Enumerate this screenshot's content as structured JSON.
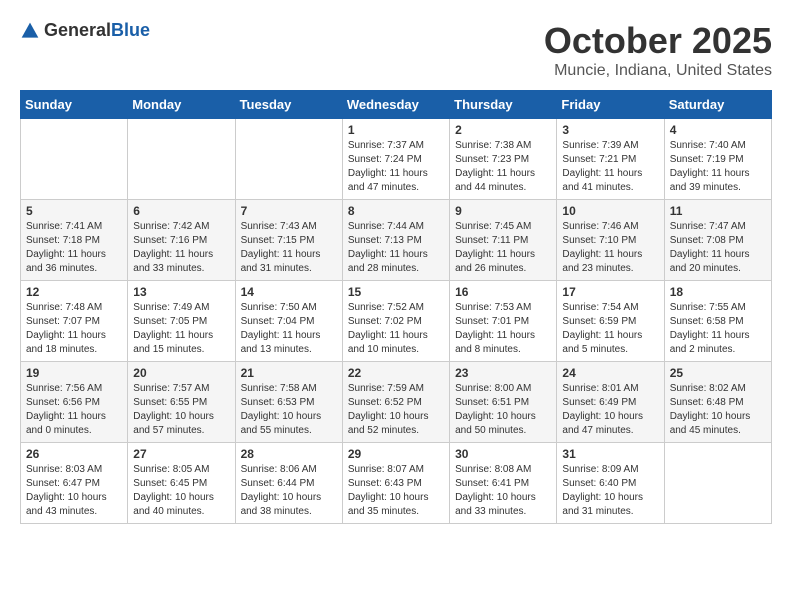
{
  "logo": {
    "general": "General",
    "blue": "Blue"
  },
  "header": {
    "month": "October 2025",
    "location": "Muncie, Indiana, United States"
  },
  "days_of_week": [
    "Sunday",
    "Monday",
    "Tuesday",
    "Wednesday",
    "Thursday",
    "Friday",
    "Saturday"
  ],
  "weeks": [
    [
      {
        "day": "",
        "info": ""
      },
      {
        "day": "",
        "info": ""
      },
      {
        "day": "",
        "info": ""
      },
      {
        "day": "1",
        "info": "Sunrise: 7:37 AM\nSunset: 7:24 PM\nDaylight: 11 hours\nand 47 minutes."
      },
      {
        "day": "2",
        "info": "Sunrise: 7:38 AM\nSunset: 7:23 PM\nDaylight: 11 hours\nand 44 minutes."
      },
      {
        "day": "3",
        "info": "Sunrise: 7:39 AM\nSunset: 7:21 PM\nDaylight: 11 hours\nand 41 minutes."
      },
      {
        "day": "4",
        "info": "Sunrise: 7:40 AM\nSunset: 7:19 PM\nDaylight: 11 hours\nand 39 minutes."
      }
    ],
    [
      {
        "day": "5",
        "info": "Sunrise: 7:41 AM\nSunset: 7:18 PM\nDaylight: 11 hours\nand 36 minutes."
      },
      {
        "day": "6",
        "info": "Sunrise: 7:42 AM\nSunset: 7:16 PM\nDaylight: 11 hours\nand 33 minutes."
      },
      {
        "day": "7",
        "info": "Sunrise: 7:43 AM\nSunset: 7:15 PM\nDaylight: 11 hours\nand 31 minutes."
      },
      {
        "day": "8",
        "info": "Sunrise: 7:44 AM\nSunset: 7:13 PM\nDaylight: 11 hours\nand 28 minutes."
      },
      {
        "day": "9",
        "info": "Sunrise: 7:45 AM\nSunset: 7:11 PM\nDaylight: 11 hours\nand 26 minutes."
      },
      {
        "day": "10",
        "info": "Sunrise: 7:46 AM\nSunset: 7:10 PM\nDaylight: 11 hours\nand 23 minutes."
      },
      {
        "day": "11",
        "info": "Sunrise: 7:47 AM\nSunset: 7:08 PM\nDaylight: 11 hours\nand 20 minutes."
      }
    ],
    [
      {
        "day": "12",
        "info": "Sunrise: 7:48 AM\nSunset: 7:07 PM\nDaylight: 11 hours\nand 18 minutes."
      },
      {
        "day": "13",
        "info": "Sunrise: 7:49 AM\nSunset: 7:05 PM\nDaylight: 11 hours\nand 15 minutes."
      },
      {
        "day": "14",
        "info": "Sunrise: 7:50 AM\nSunset: 7:04 PM\nDaylight: 11 hours\nand 13 minutes."
      },
      {
        "day": "15",
        "info": "Sunrise: 7:52 AM\nSunset: 7:02 PM\nDaylight: 11 hours\nand 10 minutes."
      },
      {
        "day": "16",
        "info": "Sunrise: 7:53 AM\nSunset: 7:01 PM\nDaylight: 11 hours\nand 8 minutes."
      },
      {
        "day": "17",
        "info": "Sunrise: 7:54 AM\nSunset: 6:59 PM\nDaylight: 11 hours\nand 5 minutes."
      },
      {
        "day": "18",
        "info": "Sunrise: 7:55 AM\nSunset: 6:58 PM\nDaylight: 11 hours\nand 2 minutes."
      }
    ],
    [
      {
        "day": "19",
        "info": "Sunrise: 7:56 AM\nSunset: 6:56 PM\nDaylight: 11 hours\nand 0 minutes."
      },
      {
        "day": "20",
        "info": "Sunrise: 7:57 AM\nSunset: 6:55 PM\nDaylight: 10 hours\nand 57 minutes."
      },
      {
        "day": "21",
        "info": "Sunrise: 7:58 AM\nSunset: 6:53 PM\nDaylight: 10 hours\nand 55 minutes."
      },
      {
        "day": "22",
        "info": "Sunrise: 7:59 AM\nSunset: 6:52 PM\nDaylight: 10 hours\nand 52 minutes."
      },
      {
        "day": "23",
        "info": "Sunrise: 8:00 AM\nSunset: 6:51 PM\nDaylight: 10 hours\nand 50 minutes."
      },
      {
        "day": "24",
        "info": "Sunrise: 8:01 AM\nSunset: 6:49 PM\nDaylight: 10 hours\nand 47 minutes."
      },
      {
        "day": "25",
        "info": "Sunrise: 8:02 AM\nSunset: 6:48 PM\nDaylight: 10 hours\nand 45 minutes."
      }
    ],
    [
      {
        "day": "26",
        "info": "Sunrise: 8:03 AM\nSunset: 6:47 PM\nDaylight: 10 hours\nand 43 minutes."
      },
      {
        "day": "27",
        "info": "Sunrise: 8:05 AM\nSunset: 6:45 PM\nDaylight: 10 hours\nand 40 minutes."
      },
      {
        "day": "28",
        "info": "Sunrise: 8:06 AM\nSunset: 6:44 PM\nDaylight: 10 hours\nand 38 minutes."
      },
      {
        "day": "29",
        "info": "Sunrise: 8:07 AM\nSunset: 6:43 PM\nDaylight: 10 hours\nand 35 minutes."
      },
      {
        "day": "30",
        "info": "Sunrise: 8:08 AM\nSunset: 6:41 PM\nDaylight: 10 hours\nand 33 minutes."
      },
      {
        "day": "31",
        "info": "Sunrise: 8:09 AM\nSunset: 6:40 PM\nDaylight: 10 hours\nand 31 minutes."
      },
      {
        "day": "",
        "info": ""
      }
    ]
  ]
}
